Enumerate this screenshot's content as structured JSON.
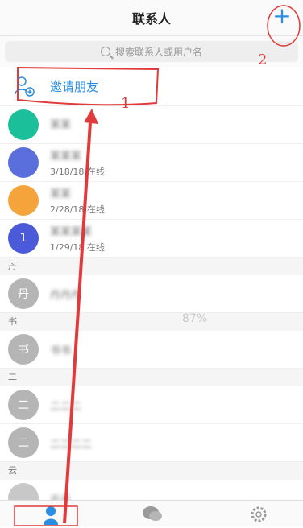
{
  "header": {
    "title": "联系人",
    "add_label": "+"
  },
  "search": {
    "placeholder": "搜索联系人或用户名"
  },
  "invite": {
    "label": "邀请朋友"
  },
  "contacts_top": [
    {
      "avatar_color": "#1bbf9a",
      "avatar_text": "",
      "name": "某某",
      "status": ""
    },
    {
      "avatar_color": "#5a6fdc",
      "avatar_text": "",
      "name": "某某某",
      "status": "3/18/18 在线"
    },
    {
      "avatar_color": "#f4a43a",
      "avatar_text": "",
      "name": "某某",
      "status": "2/28/18 在线"
    },
    {
      "avatar_color": "#4a5ad8",
      "avatar_text": "1",
      "name": "某某某某",
      "status": "1/29/18 在线"
    }
  ],
  "sections": [
    {
      "letter": "丹",
      "items": [
        {
          "avatar_text": "丹",
          "name": "丹丹丹"
        }
      ]
    },
    {
      "letter": "书",
      "items": [
        {
          "avatar_text": "书",
          "name": "书书"
        }
      ]
    },
    {
      "letter": "二",
      "items": [
        {
          "avatar_text": "二",
          "name": "二二二"
        },
        {
          "avatar_text": "二",
          "name": "二二二二"
        }
      ]
    },
    {
      "letter": "云",
      "items": [
        {
          "avatar_text": "",
          "name": "云云"
        }
      ]
    }
  ],
  "overlay": {
    "watermark": "87%",
    "annot_1": "1",
    "annot_2": "2"
  },
  "colors": {
    "accent": "#2b8de3",
    "annotation": "#e03a3a",
    "gray_avatar": "#b5b5b5"
  }
}
